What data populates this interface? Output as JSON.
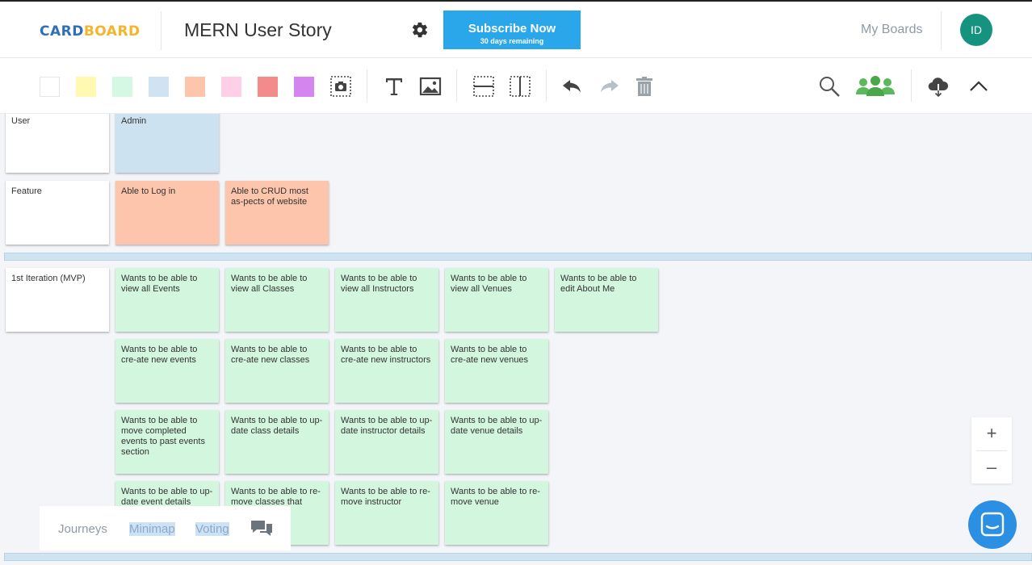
{
  "header": {
    "logo_part1": "CARD",
    "logo_part2": "BOARD",
    "board_title": "MERN User Story",
    "settings_icon": "gear-icon",
    "subscribe_label": "Subscribe Now",
    "subscribe_sub": "30 days remaining",
    "my_boards": "My Boards",
    "avatar_initials": "ID"
  },
  "toolbar": {
    "swatches": [
      "#ffffff",
      "#fff9b1",
      "#d4f8e3",
      "#cfe3f2",
      "#fdc6ac",
      "#fdd0e8",
      "#f38b8b",
      "#d485f0"
    ],
    "icons": [
      "camera-frame-icon",
      "text-icon",
      "image-icon",
      "horizontal-lane-icon",
      "vertical-lane-icon",
      "undo-icon",
      "redo-icon",
      "trash-icon",
      "search-icon",
      "users-icon",
      "cloud-download-icon",
      "chevron-up-icon"
    ],
    "accent_green": "#5cb85c"
  },
  "rows": {
    "user_label": "User",
    "feature_label": "Feature",
    "iteration_label": "1st Iteration (MVP)"
  },
  "cards": {
    "admin": "Admin",
    "feat1": "Able to Log in",
    "feat2": "Able to CRUD most as-pects of website",
    "r1": [
      "Wants to be able to view all Events",
      "Wants to be able to view all Classes",
      "Wants to be able to view all Instructors",
      "Wants to be able to view all Venues",
      "Wants to be able to edit About Me"
    ],
    "r2": [
      "Wants to be able to cre-ate new events",
      "Wants to be able to cre-ate new classes",
      "Wants to be able to cre-ate new instructors",
      "Wants to be able to cre-ate new venues"
    ],
    "r3": [
      "Wants to be able to move completed events to past events section",
      "Wants to be able to up-date class details",
      "Wants to be able to up-date instructor details",
      "Wants to be able to up-date venue details"
    ],
    "r4": [
      "Wants to be able to up-date event details",
      "Wants to be able to re-move classes that have",
      "Wants to be able to re-move instructor",
      "Wants to be able to re-move venue"
    ]
  },
  "bottom_tabs": {
    "journeys": "Journeys",
    "minimap": "Minimap",
    "voting": "Voting",
    "chat_icon": "chat-icon"
  },
  "zoom": {
    "plus": "+",
    "minus": "–"
  },
  "messenger_icon": "messenger-icon"
}
